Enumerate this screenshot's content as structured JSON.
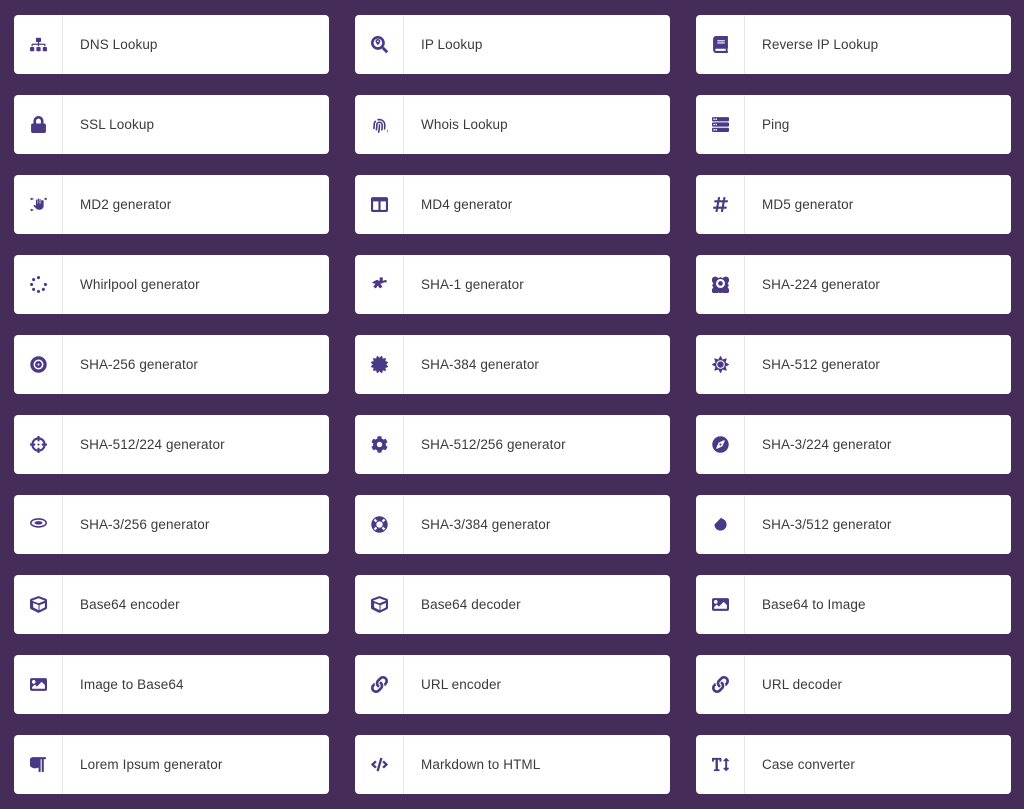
{
  "theme": {
    "page_background": "#452C59",
    "card_background": "#FFFFFF",
    "icon_color": "#4A3A86",
    "label_color": "#3B3B3B",
    "divider_color": "#E6E6EA"
  },
  "grid": {
    "columns": 3,
    "rows": 10,
    "total_tools": 30
  },
  "tools": [
    {
      "label": "DNS Lookup",
      "icon": "sitemap-icon"
    },
    {
      "label": "IP Lookup",
      "icon": "search-location-icon"
    },
    {
      "label": "Reverse IP Lookup",
      "icon": "book-icon"
    },
    {
      "label": "SSL Lookup",
      "icon": "lock-icon"
    },
    {
      "label": "Whois Lookup",
      "icon": "fingerprint-icon"
    },
    {
      "label": "Ping",
      "icon": "server-icon"
    },
    {
      "label": "MD2 generator",
      "icon": "hand-sparkles-icon"
    },
    {
      "label": "MD4 generator",
      "icon": "columns-icon"
    },
    {
      "label": "MD5 generator",
      "icon": "hashtag-icon"
    },
    {
      "label": "Whirlpool generator",
      "icon": "spinner-dots-icon"
    },
    {
      "label": "SHA-1 generator",
      "icon": "asterisk-icon"
    },
    {
      "label": "SHA-224 generator",
      "icon": "atom-icon"
    },
    {
      "label": "SHA-256 generator",
      "icon": "record-vinyl-icon"
    },
    {
      "label": "SHA-384 generator",
      "icon": "certificate-icon"
    },
    {
      "label": "SHA-512 generator",
      "icon": "sun-icon"
    },
    {
      "label": "SHA-512/224 generator",
      "icon": "crosshairs-icon"
    },
    {
      "label": "SHA-512/256 generator",
      "icon": "cog-icon"
    },
    {
      "label": "SHA-3/224 generator",
      "icon": "compass-icon"
    },
    {
      "label": "SHA-3/256 generator",
      "icon": "ring-icon"
    },
    {
      "label": "SHA-3/384 generator",
      "icon": "life-ring-icon"
    },
    {
      "label": "SHA-3/512 generator",
      "icon": "circle-notch-icon"
    },
    {
      "label": "Base64 encoder",
      "icon": "cube-icon"
    },
    {
      "label": "Base64 decoder",
      "icon": "cube-icon"
    },
    {
      "label": "Base64 to Image",
      "icon": "image-icon"
    },
    {
      "label": "Image to Base64",
      "icon": "image-icon"
    },
    {
      "label": "URL encoder",
      "icon": "link-icon"
    },
    {
      "label": "URL decoder",
      "icon": "link-icon"
    },
    {
      "label": "Lorem Ipsum generator",
      "icon": "paragraph-icon"
    },
    {
      "label": "Markdown to HTML",
      "icon": "code-icon"
    },
    {
      "label": "Case converter",
      "icon": "text-height-icon"
    }
  ]
}
